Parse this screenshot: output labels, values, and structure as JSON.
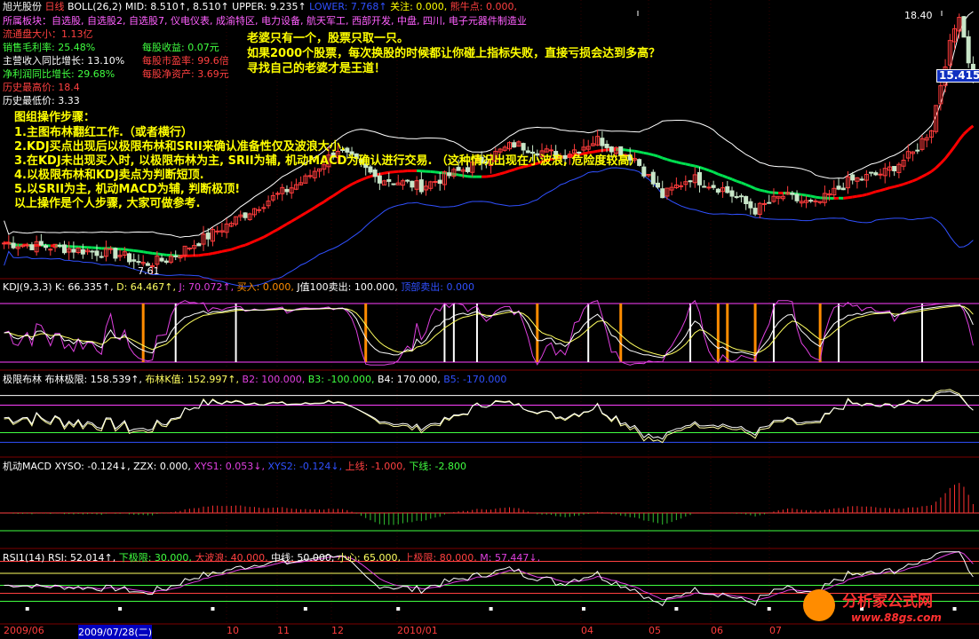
{
  "colors": {
    "background": "#000000",
    "grid": "#7d0000",
    "candle_up": "#ff3c3c",
    "candle_down": "#c8e6c8",
    "mid_up": "#ff0000",
    "mid_down": "#00e050",
    "upper": "#ffffff",
    "lower": "#3050ff",
    "kdj_k": "#ffffff",
    "kdj_d": "#ffff60",
    "kdj_j": "#e040e0",
    "buy": "#ff8c00",
    "sell": "#3030ff",
    "rsi": "#ffffff",
    "ma": "#e040e0"
  },
  "main_header": {
    "stock": "旭光股份",
    "period": "日线",
    "indicator": "BOLL(26,2)",
    "mid": "MID: 8.510↑, 8.510↑",
    "upper": "UPPER: 9.235↑",
    "lower": "LOWER: 7.768↑",
    "guanzhu": "关注: 0.000,",
    "niudian": "熊牛点: 0.000,"
  },
  "sector_line": "所属板块：自选股, 自选股2, 自选股7, 仪电仪表, 成渝特区, 电力设备, 航天军工, 西部开发, 中盘, 四川, 电子元器件制造业",
  "fundamentals": {
    "float_cap": "流通盘大小：1.13亿",
    "gross_margin": "销售毛利率: 25.48%",
    "revenue_growth": "主营收入同比增长: 13.10%",
    "profit_growth": "净利润同比增长: 29.68%",
    "hist_high": "历史最高价: 18.4",
    "hist_low": "历史最低价: 3.33",
    "eps": "每股收益: 0.07元",
    "pe": "每股市盈率: 99.6倍",
    "nav": "每股净资产: 3.69元"
  },
  "quote": [
    "老婆只有一个，股票只取一只。",
    "如果2000个股票，每次换股的时候都让你碰上指标失败，直接亏损会达到多高？",
    "寻找自己的老婆才是王道！"
  ],
  "steps": {
    "title": "图组操作步骤：",
    "items": [
      "1.主图布林翻红工作.（或者横行）",
      "2.KDJ买点出现后以极限布林和SRII来确认准备性仅及波浪大小.",
      "3.在KDJ未出现买入时, 以极限布林为主, SRII为辅, 机动MACD为确认进行交易. （这种情况出现在小波浪, 危险度较高）",
      "4.以极限布林和KDJ卖点为判断短顶.",
      "5.以SRII为主, 机动MACD为辅, 判断极顶!",
      "以上操作是个人步骤, 大家可做参考."
    ]
  },
  "price_labels": {
    "high": "18.40",
    "low": "7.61",
    "last": "15.415"
  },
  "kdj_header": {
    "name": "KDJ(9,3,3)",
    "k": "K: 66.335↑,",
    "d": "D: 64.467↑,",
    "j": "J: 70.072↑,",
    "buy": "买入: 0.000,",
    "sell": "J值100卖出: 100.000,",
    "top": "顶部卖出: 0.000"
  },
  "jixian_header": {
    "name": "极限布林",
    "v1": "布林极限: 158.539↑,",
    "v2": "布林K值: 152.997↑,",
    "b2": "B2: 100.000,",
    "b3": "B3: -100.000,",
    "b4": "B4: 170.000,",
    "b5": "B5: -170.000"
  },
  "macd_header": {
    "name": "机动MACD",
    "xyso": "XYSO: -0.124↓,",
    "zzx": "ZZX: 0.000,",
    "xys1": "XYS1: 0.053↓,",
    "xys2": "XYS2: -0.124↓,",
    "up": "上线: -1.000,",
    "down": "下线: -2.800"
  },
  "rsi_header": {
    "name": "RSI1(14)",
    "rsi": "RSI: 52.014↑,",
    "low": "下极限: 30.000,",
    "big": "大波浪: 40.000,",
    "mid": "中线: 50.000,",
    "careful": "小心: 65.000,",
    "high": "上极限: 80.000,",
    "m": "M: 57.447↓,"
  },
  "date_axis": [
    "2009/06",
    "2009/07/28(二)",
    "10",
    "11",
    "12",
    "2010/01",
    "04",
    "05",
    "06",
    "07"
  ],
  "watermark": {
    "name": "分析家公式网",
    "url": "www.88gs.com"
  },
  "chart_data": {
    "type": "line",
    "title": "旭光股份 日线 BOLL(26,2)",
    "bars": 210,
    "price_range": [
      7.61,
      18.4
    ],
    "close_keypoints": [
      [
        0,
        8.6
      ],
      [
        12,
        8.4
      ],
      [
        25,
        8.1
      ],
      [
        30,
        7.7
      ],
      [
        35,
        7.9
      ],
      [
        45,
        9.0
      ],
      [
        55,
        10.2
      ],
      [
        65,
        11.3
      ],
      [
        72,
        12.6
      ],
      [
        80,
        11.4
      ],
      [
        90,
        11.0
      ],
      [
        100,
        11.8
      ],
      [
        110,
        12.8
      ],
      [
        120,
        12.3
      ],
      [
        128,
        13.0
      ],
      [
        136,
        12.2
      ],
      [
        142,
        10.6
      ],
      [
        148,
        11.4
      ],
      [
        155,
        10.9
      ],
      [
        162,
        10.0
      ],
      [
        168,
        10.6
      ],
      [
        175,
        10.2
      ],
      [
        182,
        11.2
      ],
      [
        190,
        11.6
      ],
      [
        196,
        12.4
      ],
      [
        200,
        13.5
      ],
      [
        203,
        16.3
      ],
      [
        206,
        18.4
      ],
      [
        209,
        15.4
      ]
    ],
    "rsi_levels": [
      30,
      40,
      50,
      65,
      80
    ]
  }
}
